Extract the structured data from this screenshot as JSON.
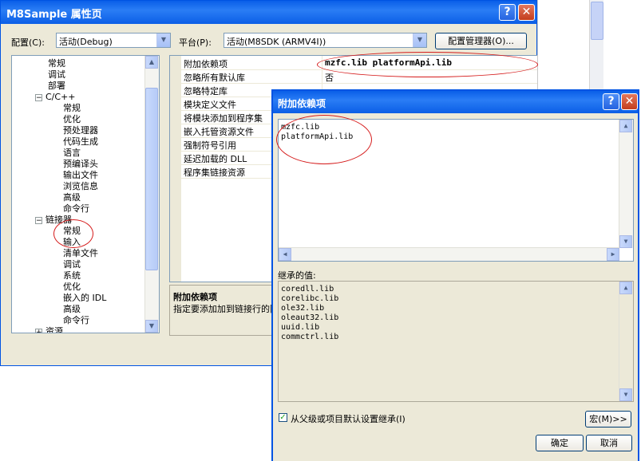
{
  "main_dialog": {
    "title": "M8Sample 属性页",
    "help_glyph": "?",
    "close_glyph": "✕",
    "config_label": "配置(C):",
    "config_value": "活动(Debug)",
    "platform_label": "平台(P):",
    "platform_value": "活动(M8SDK (ARMV4I))",
    "config_manager_label": "配置管理器(O)..."
  },
  "tree": {
    "items": [
      {
        "label": "常规",
        "level": 1
      },
      {
        "label": "调试",
        "level": 1
      },
      {
        "label": "部署",
        "level": 1
      },
      {
        "label": "C/C++",
        "level": 0,
        "expanded": true
      },
      {
        "label": "常规",
        "level": 2
      },
      {
        "label": "优化",
        "level": 2
      },
      {
        "label": "预处理器",
        "level": 2
      },
      {
        "label": "代码生成",
        "level": 2
      },
      {
        "label": "语言",
        "level": 2
      },
      {
        "label": "预编译头",
        "level": 2
      },
      {
        "label": "输出文件",
        "level": 2
      },
      {
        "label": "浏览信息",
        "level": 2
      },
      {
        "label": "高级",
        "level": 2
      },
      {
        "label": "命令行",
        "level": 2
      },
      {
        "label": "链接器",
        "level": 0,
        "expanded": true
      },
      {
        "label": "常规",
        "level": 2
      },
      {
        "label": "输入",
        "level": 2
      },
      {
        "label": "清单文件",
        "level": 2
      },
      {
        "label": "调试",
        "level": 2
      },
      {
        "label": "系统",
        "level": 2
      },
      {
        "label": "优化",
        "level": 2
      },
      {
        "label": "嵌入的 IDL",
        "level": 2
      },
      {
        "label": "高级",
        "level": 2
      },
      {
        "label": "命令行",
        "level": 2
      },
      {
        "label": "资源",
        "level": 0,
        "expanded": false
      }
    ]
  },
  "properties": {
    "rows": [
      {
        "name": "附加依赖项",
        "value": "mzfc.lib platformApi.lib"
      },
      {
        "name": "忽略所有默认库",
        "value": "否"
      },
      {
        "name": "忽略特定库",
        "value": ""
      },
      {
        "name": "模块定义文件",
        "value": ""
      },
      {
        "name": "将模块添加到程序集",
        "value": ""
      },
      {
        "name": "嵌入托管资源文件",
        "value": ""
      },
      {
        "name": "强制符号引用",
        "value": ""
      },
      {
        "name": "延迟加载的 DLL",
        "value": ""
      },
      {
        "name": "程序集链接资源",
        "value": ""
      }
    ],
    "description_title": "附加依赖项",
    "description_text": "指定要添加加到链接行的附"
  },
  "sub_dialog": {
    "title": "附加依赖项",
    "help_glyph": "?",
    "close_glyph": "✕",
    "entries": [
      "mzfc.lib",
      "platformApi.lib"
    ],
    "inherited_label": "继承的值:",
    "inherited": [
      "coredll.lib",
      "corelibc.lib",
      "ole32.lib",
      "oleaut32.lib",
      "uuid.lib",
      "commctrl.lib"
    ],
    "inherit_checkbox_label": "从父级或项目默认设置继承(I)",
    "inherit_checked": true,
    "check_glyph": "✓",
    "macro_button": "宏(M)>>",
    "ok_button": "确定",
    "cancel_button": "取消"
  },
  "colors": {
    "title_bar": "#0a5fe8",
    "dialog_bg": "#ece9d8",
    "annotation": "#d51b1b"
  }
}
